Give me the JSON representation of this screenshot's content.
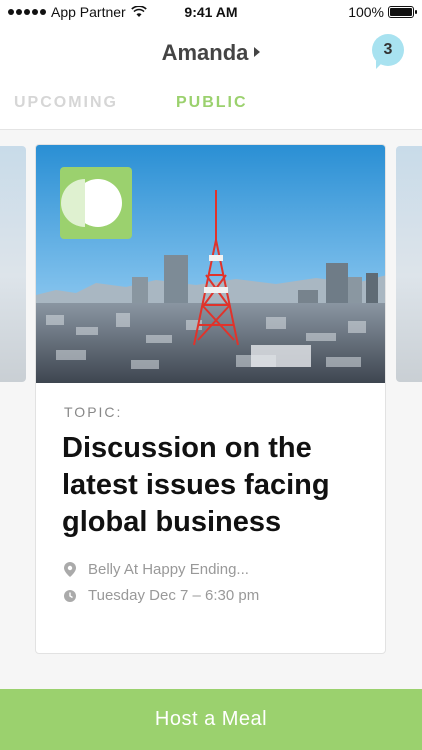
{
  "status_bar": {
    "carrier": "App Partner",
    "time": "9:41 AM",
    "battery": "100%"
  },
  "header": {
    "user_name": "Amanda",
    "notification_count": "3"
  },
  "tabs": [
    {
      "label": "UPCOMING",
      "active": false
    },
    {
      "label": "PUBLIC",
      "active": true
    }
  ],
  "card": {
    "image_icon": "tokyo-tower-cityscape",
    "logo_icon": "pattern-logo",
    "topic_label": "TOPIC:",
    "title": "Discussion on the latest issues facing global business",
    "location": "Belly At Happy Ending...",
    "datetime": "Tuesday Dec 7 – 6:30 pm"
  },
  "cta": {
    "label": "Host a Meal"
  },
  "colors": {
    "accent": "#9bd16e",
    "notification": "#a8e2f0"
  }
}
